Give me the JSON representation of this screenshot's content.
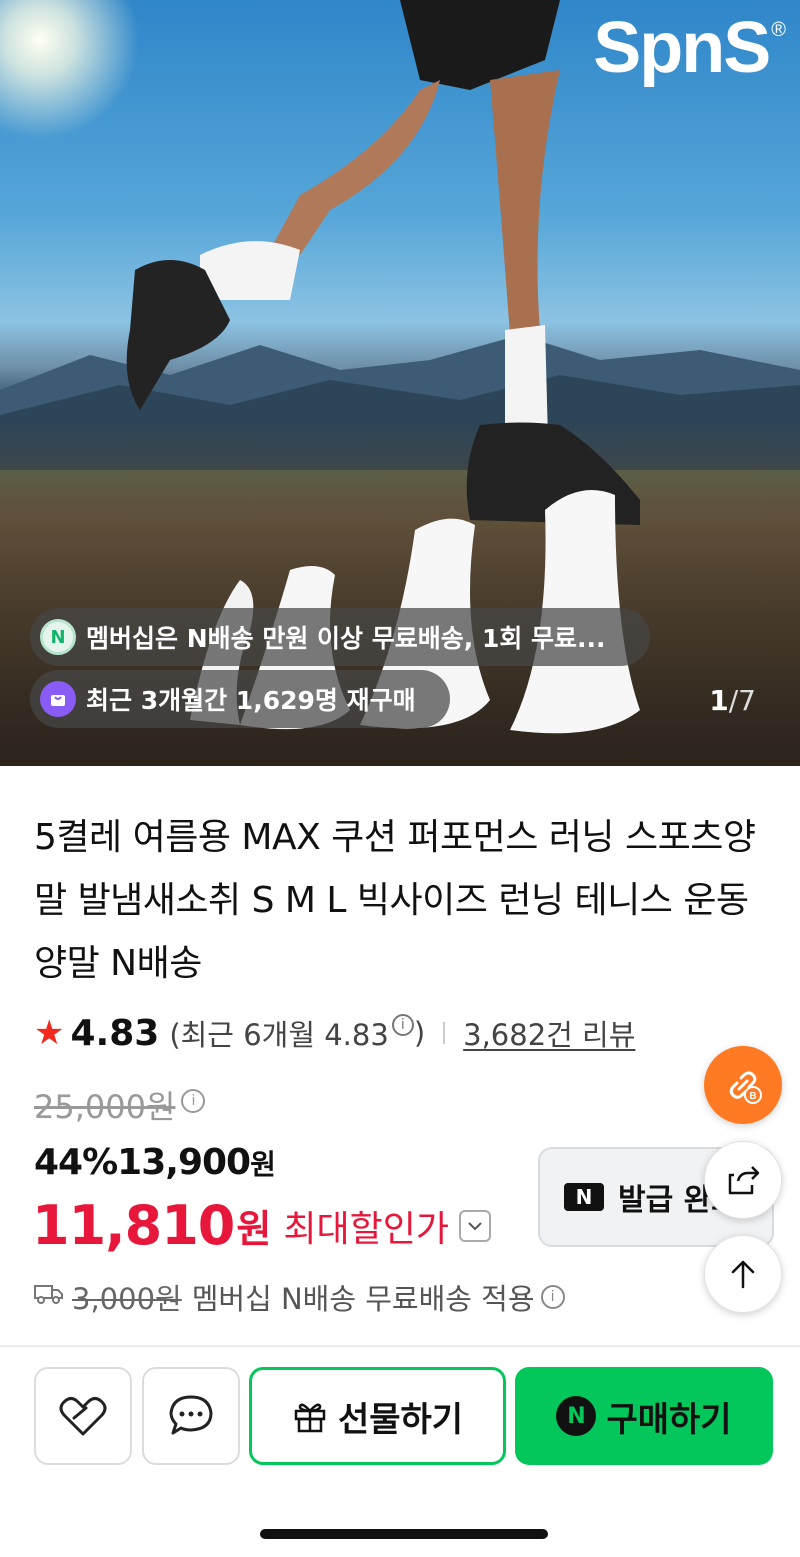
{
  "hero": {
    "brand": "SpnS",
    "brand_mark": "®",
    "pill_membership": "멤버십은 N배송 만원 이상 무료배송, 1회 무료...",
    "pill_membership_icon": "N",
    "pill_repurchase": "최근 3개월간 1,629명 재구매",
    "counter_current": "1",
    "counter_sep": "/",
    "counter_total": "7"
  },
  "product": {
    "title": "5켤레 여름용 MAX 쿠션 퍼포먼스 러닝 스포츠양말 발냄새소취 S M L 빅사이즈 런닝 테니스 운동양말 N배송"
  },
  "rating": {
    "star": "★",
    "score": "4.83",
    "recent_text": "(최근 6개월 4.83",
    "recent_close": ")",
    "info": "i",
    "reviews": "3,682건 리뷰"
  },
  "price": {
    "original": "25,000원",
    "discount_rate": "44%",
    "sale_number": "13,900",
    "sale_unit": "원",
    "max_number": "11,810",
    "max_unit": "원",
    "max_label": "최대할인가",
    "chevron": "⌄",
    "info": "i"
  },
  "coupon": {
    "badge": "N",
    "label": "발급 완료"
  },
  "shipping": {
    "original_fee": "3,000원",
    "text": "멤버십 N배송 무료배송 적용",
    "info": "i"
  },
  "bottom_bar": {
    "gift_label": "선물하기",
    "buy_label": "구매하기",
    "buy_logo": "N"
  },
  "colors": {
    "accent_green": "#03c75a",
    "price_red": "#e6173a",
    "star_red": "#f2291d",
    "fab_orange": "#ff7a22"
  }
}
